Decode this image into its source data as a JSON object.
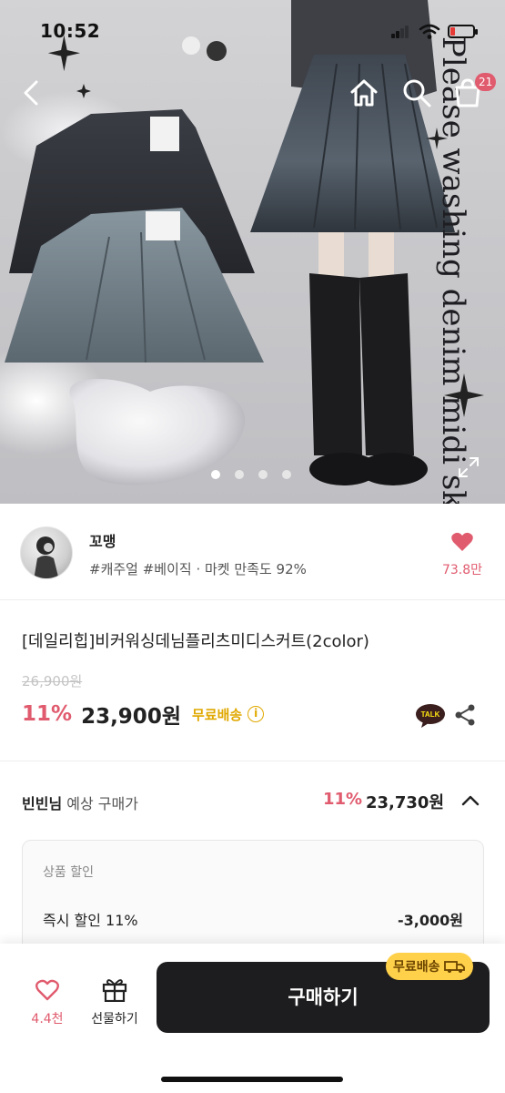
{
  "status_bar": {
    "time": "10:52"
  },
  "hero": {
    "overlay_text": "Please washing denim midi skirt",
    "carousel": {
      "count": 4,
      "active": 0
    },
    "cart_count": "21"
  },
  "seller": {
    "name": "꼬맹",
    "tags": "#캐주얼 #베이직 · 마켓 만족도 92%",
    "like_count": "73.8만"
  },
  "product": {
    "title": "[데일리힙]비커워싱데님플리츠미디스커트(2color)",
    "original_price": "26,900원",
    "discount_rate": "11%",
    "sale_price": "23,900원",
    "free_shipping": "무료배송",
    "talk_label": "TALK"
  },
  "expected": {
    "user": "빈빈님",
    "label": "예상 구매가",
    "rate": "11%",
    "price": "23,730원",
    "breakdown": {
      "header": "상품 할인",
      "row_label": "즉시 할인 11%",
      "row_value": "-3,000원"
    }
  },
  "bottom_bar": {
    "wish_count": "4.4천",
    "gift_label": "선물하기",
    "buy_label": "구매하기",
    "free_badge": "무료배송"
  },
  "colors": {
    "accent_pink": "#e05b6e",
    "shipping_yellow": "#e0a800",
    "buy_button": "#1d1d1f"
  },
  "icons": [
    "back-arrow-icon",
    "home-icon",
    "search-icon",
    "cart-icon",
    "expand-icon",
    "heart-icon",
    "kakao-talk-icon",
    "share-icon",
    "info-icon",
    "chevron-up-icon",
    "gift-icon",
    "truck-icon"
  ]
}
